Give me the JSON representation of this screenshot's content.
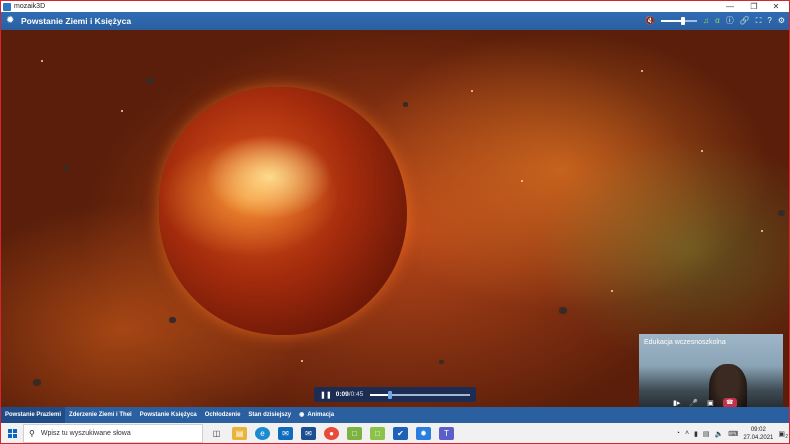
{
  "window": {
    "app_title": "mozaik3D"
  },
  "header": {
    "title": "Powstanie Ziemi i Księżyca",
    "volume": 0.6
  },
  "player": {
    "elapsed": "0:09",
    "total": "0:45",
    "progress": 0.2
  },
  "call": {
    "label": "Edukacja wczesnoszkolna"
  },
  "tabs": [
    {
      "label": "Powstanie PrazIemi"
    },
    {
      "label": "Zderzenie Ziemi i Thei"
    },
    {
      "label": "Powstanie Księżyca"
    },
    {
      "label": "Ochłodzenie"
    },
    {
      "label": "Stan dzisiejszy"
    },
    {
      "label": "Animacja"
    }
  ],
  "taskbar": {
    "search_placeholder": "Wpisz tu wyszukiwane słowa",
    "time": "09:02",
    "date": "27.04.2021",
    "notification_count": "2"
  },
  "colors": {
    "header_blue": "#2a5fa0",
    "end_call": "#c4314b"
  }
}
